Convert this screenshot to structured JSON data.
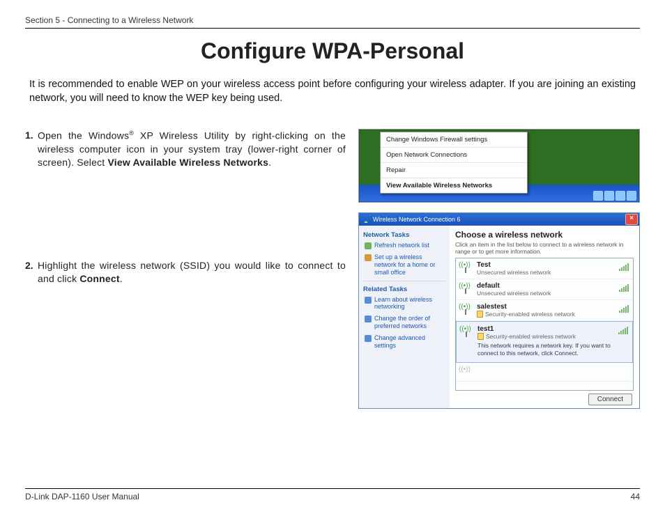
{
  "header": "Section 5 - Connecting to a Wireless Network",
  "title": "Configure WPA-Personal",
  "intro": "It is recommended to enable WEP on your wireless access point before configuring your wireless adapter. If you are joining an existing network, you will need to know the WEP key being used.",
  "steps": [
    {
      "n": "1.",
      "pre": "Open the Windows",
      "reg": "®",
      "mid": " XP Wireless Utility by right-clicking on the wireless computer icon in your system tray (lower-right corner of screen). Select ",
      "bold": "View Available Wireless Networks",
      "post": "."
    },
    {
      "n": "2.",
      "pre": "Highlight the wireless network (SSID) you would like to connect to and click ",
      "bold": "Connect",
      "post": "."
    }
  ],
  "ctx": {
    "i1": "Change Windows Firewall settings",
    "i2": "Open Network Connections",
    "i3": "Repair",
    "i4": "View Available Wireless Networks"
  },
  "dlg": {
    "title": "Wireless Network Connection 6",
    "side": {
      "h1": "Network Tasks",
      "a": "Refresh network list",
      "b": "Set up a wireless network for a home or small office",
      "h2": "Related Tasks",
      "c": "Learn about wireless networking",
      "d": "Change the order of preferred networks",
      "e": "Change advanced settings"
    },
    "main": {
      "title": "Choose a wireless network",
      "sub": "Click an item in the list below to connect to a wireless network in range or to get more information.",
      "unsec": "Unsecured wireless network",
      "sec": "Security-enabled wireless network",
      "nets": [
        "Test",
        "default",
        "salestest",
        "test1"
      ],
      "selextra": "This network requires a network key. If you want to connect to this network, click Connect.",
      "btn": "Connect"
    }
  },
  "footer": {
    "left": "D-Link DAP-1160 User Manual",
    "right": "44"
  }
}
